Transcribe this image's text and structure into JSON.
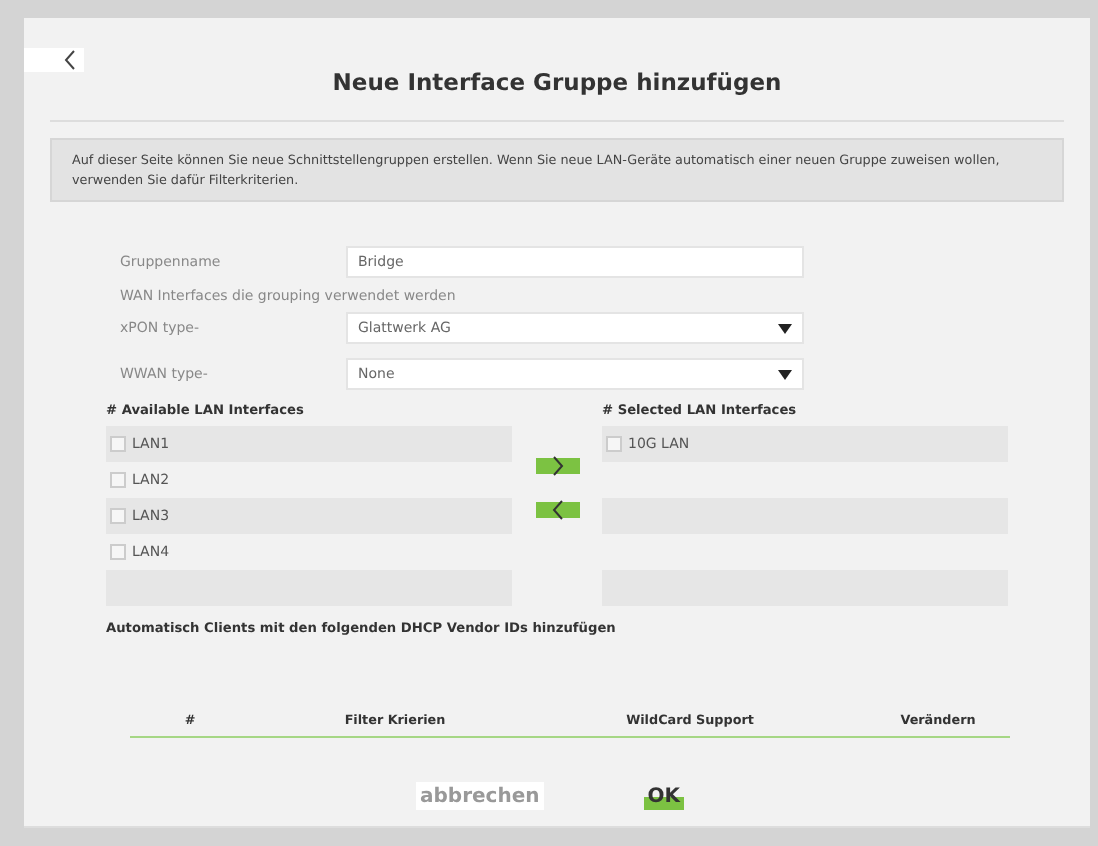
{
  "title": "Neue Interface Gruppe hinzufügen",
  "info": "Auf dieser Seite können Sie neue Schnittstellengruppen erstellen. Wenn Sie neue LAN-Geräte automatisch einer neuen Gruppe zuweisen wollen, verwenden Sie dafür Filterkriterien.",
  "group_name": {
    "label": "Gruppenname",
    "value": "Bridge"
  },
  "wan_heading": "WAN Interfaces die grouping verwendet werden",
  "selects": [
    {
      "label": "xPON type-",
      "value": "Glattwerk AG"
    },
    {
      "label": "WWAN type-",
      "value": "None"
    }
  ],
  "available": {
    "heading": "# Available LAN Interfaces",
    "items": [
      {
        "label": "LAN1",
        "checked": false
      },
      {
        "label": "LAN2",
        "checked": false
      },
      {
        "label": "LAN3",
        "checked": false
      },
      {
        "label": "LAN4",
        "checked": false
      }
    ]
  },
  "selected_list": {
    "heading": "# Selected LAN Interfaces",
    "items": [
      {
        "label": "10G LAN",
        "checked": false
      }
    ]
  },
  "vendor_heading": "Automatisch Clients mit den folgenden DHCP Vendor IDs hinzufügen",
  "table": {
    "columns": [
      "#",
      "Filter Krierien",
      "WildCard Support",
      "Verändern"
    ]
  },
  "buttons": {
    "cancel": "abbrechen",
    "ok": "OK"
  }
}
